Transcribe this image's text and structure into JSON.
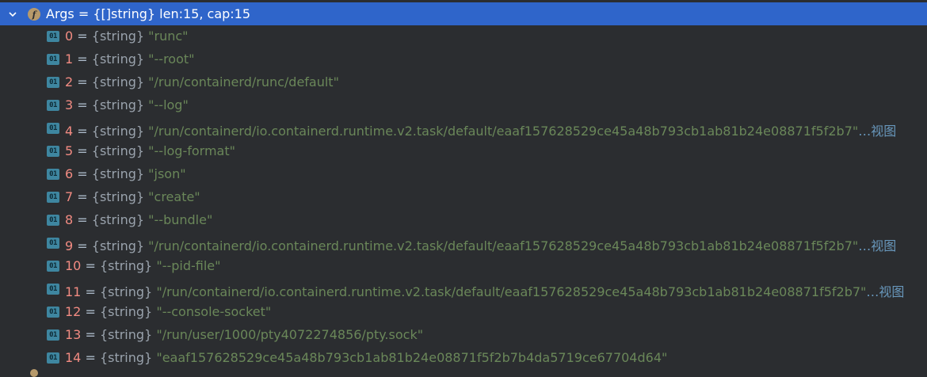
{
  "header": {
    "icon_letter": "f",
    "name": "Args",
    "equals": " = ",
    "summary": "{[]string} len:15, cap:15"
  },
  "element_icon_text": "01",
  "items": [
    {
      "index": "0",
      "type": "{string}",
      "value": "\"runc\"",
      "more": ""
    },
    {
      "index": "1",
      "type": "{string}",
      "value": "\"--root\"",
      "more": ""
    },
    {
      "index": "2",
      "type": "{string}",
      "value": "\"/run/containerd/runc/default\"",
      "more": ""
    },
    {
      "index": "3",
      "type": "{string}",
      "value": "\"--log\"",
      "more": ""
    },
    {
      "index": "4",
      "type": "{string}",
      "value": "\"/run/containerd/io.containerd.runtime.v2.task/default/eaaf157628529ce45a48b793cb1ab81b24e08871f5f2b7\"",
      "more": "…视图"
    },
    {
      "index": "5",
      "type": "{string}",
      "value": "\"--log-format\"",
      "more": ""
    },
    {
      "index": "6",
      "type": "{string}",
      "value": "\"json\"",
      "more": ""
    },
    {
      "index": "7",
      "type": "{string}",
      "value": "\"create\"",
      "more": ""
    },
    {
      "index": "8",
      "type": "{string}",
      "value": "\"--bundle\"",
      "more": ""
    },
    {
      "index": "9",
      "type": "{string}",
      "value": "\"/run/containerd/io.containerd.runtime.v2.task/default/eaaf157628529ce45a48b793cb1ab81b24e08871f5f2b7\"",
      "more": "…视图"
    },
    {
      "index": "10",
      "type": "{string}",
      "value": "\"--pid-file\"",
      "more": ""
    },
    {
      "index": "11",
      "type": "{string}",
      "value": "\"/run/containerd/io.containerd.runtime.v2.task/default/eaaf157628529ce45a48b793cb1ab81b24e08871f5f2b7\"",
      "more": "…视图"
    },
    {
      "index": "12",
      "type": "{string}",
      "value": "\"--console-socket\"",
      "more": ""
    },
    {
      "index": "13",
      "type": "{string}",
      "value": "\"/run/user/1000/pty4072274856/pty.sock\"",
      "more": ""
    },
    {
      "index": "14",
      "type": "{string}",
      "value": "\"eaaf157628529ce45a48b793cb1ab81b24e08871f5f2b7b4da5719ce67704d64\"",
      "more": ""
    }
  ],
  "colors": {
    "background": "#2b2d30",
    "selection": "#2f65ca",
    "index": "#f28b82",
    "string_value": "#6a8759",
    "link": "#6897bb"
  }
}
